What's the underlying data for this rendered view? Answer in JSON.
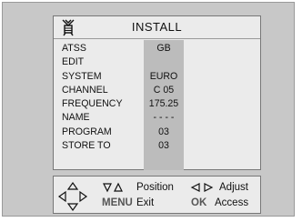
{
  "menu": {
    "title": "INSTALL",
    "rows": [
      {
        "label": "ATSS",
        "value": "GB"
      },
      {
        "label": "EDIT",
        "value": ""
      },
      {
        "label": "SYSTEM",
        "value": "EURO"
      },
      {
        "label": "CHANNEL",
        "value": "C 05"
      },
      {
        "label": "FREQUENCY",
        "value": "175.25"
      },
      {
        "label": "NAME",
        "value": "- - - -"
      },
      {
        "label": "PROGRAM",
        "value": "03"
      },
      {
        "label": "STORE TO",
        "value": "03"
      }
    ]
  },
  "help": {
    "position_label": "Position",
    "adjust_label": "Adjust",
    "menu_key": "MENU",
    "exit_label": "Exit",
    "ok_key": "OK",
    "access_label": "Access"
  }
}
